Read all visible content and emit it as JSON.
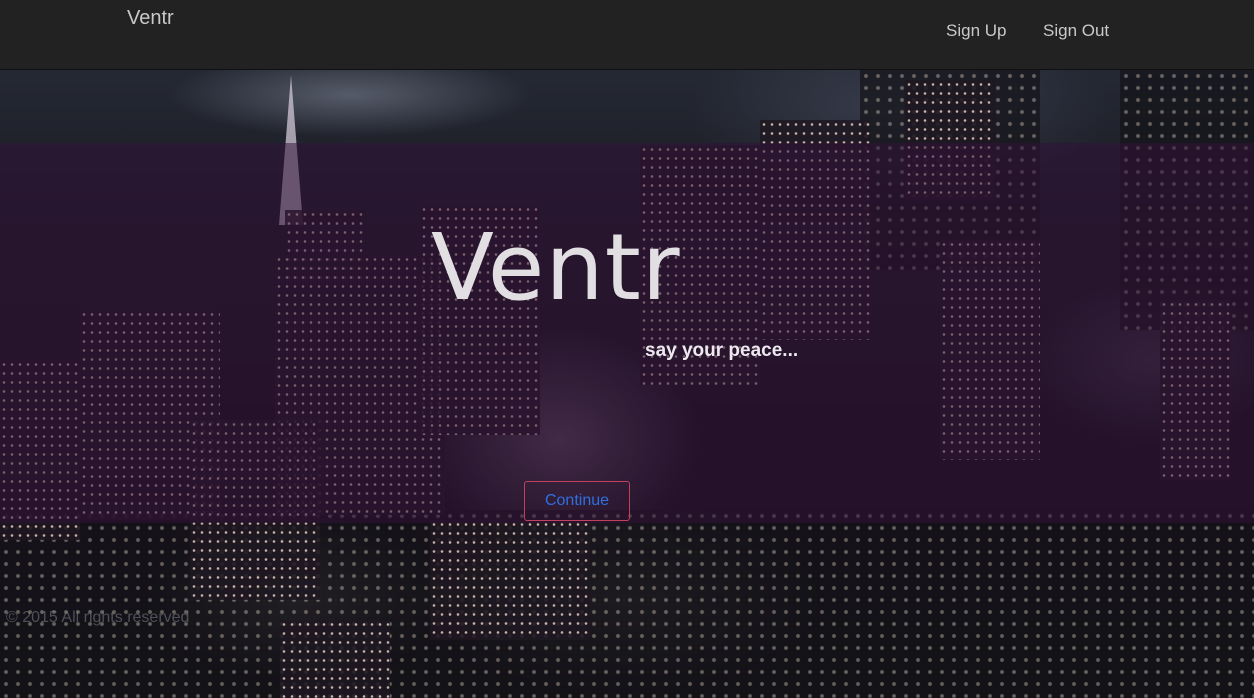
{
  "navbar": {
    "brand": "Ventr",
    "links": [
      {
        "label": "Sign Up"
      },
      {
        "label": "Sign Out"
      }
    ]
  },
  "hero": {
    "title": "Ventr",
    "tagline": "say your peace...",
    "button_label": "Continue"
  },
  "footer": {
    "copyright": "© 2015 All rights reserved"
  },
  "colors": {
    "navbar_bg": "#222222",
    "nav_text": "#c9c9c9",
    "overlay": "#34123a",
    "button_border": "#c2405e",
    "button_text": "#2f6fe0"
  }
}
